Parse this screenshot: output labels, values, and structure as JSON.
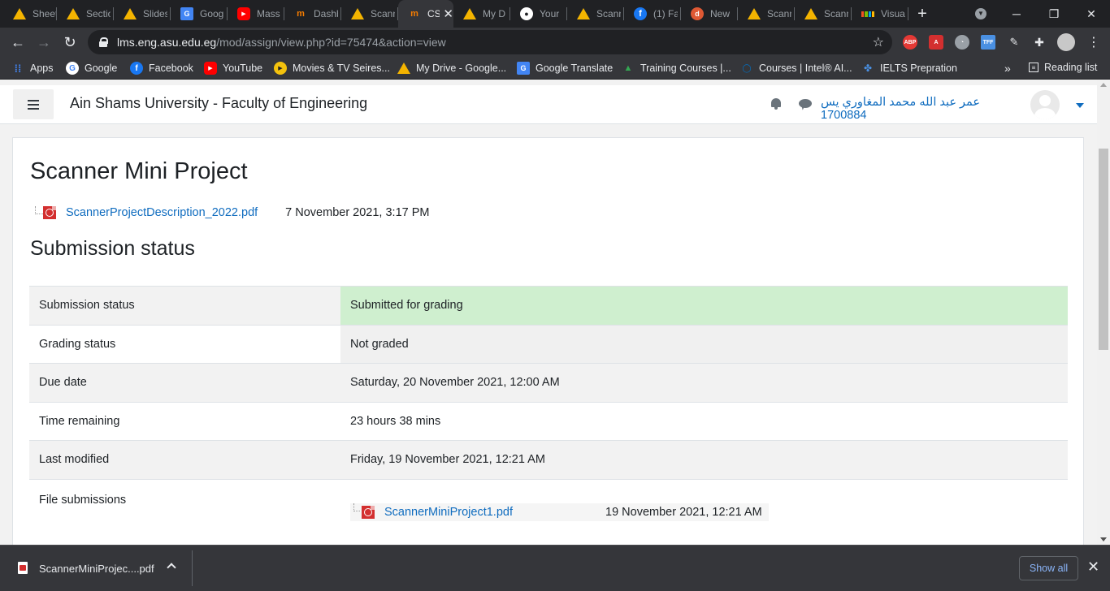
{
  "browser": {
    "tabs": [
      {
        "title": "Sheet",
        "icon": "google-drive-icon"
      },
      {
        "title": "Sectio",
        "icon": "google-drive-icon"
      },
      {
        "title": "Slides",
        "icon": "google-drive-icon"
      },
      {
        "title": "Goog",
        "icon": "google-translate-icon"
      },
      {
        "title": "Mass",
        "icon": "youtube-icon"
      },
      {
        "title": "Dashb",
        "icon": "moodle-icon"
      },
      {
        "title": "Scann",
        "icon": "google-drive-icon"
      },
      {
        "title": "CS",
        "icon": "moodle-icon",
        "active": true
      },
      {
        "title": "My D",
        "icon": "google-drive-icon"
      },
      {
        "title": "Your",
        "icon": "github-icon"
      },
      {
        "title": "Scann",
        "icon": "google-drive-icon"
      },
      {
        "title": "(1) Fa",
        "icon": "facebook-icon"
      },
      {
        "title": "New",
        "icon": "duckduckgo-icon"
      },
      {
        "title": "Scann",
        "icon": "google-drive-icon"
      },
      {
        "title": "Scann",
        "icon": "google-drive-icon"
      },
      {
        "title": "Visua",
        "icon": "microsoft-icon"
      }
    ],
    "url_host": "lms.eng.asu.edu.eg",
    "url_path": "/mod/assign/view.php?id=75474&action=view",
    "extensions": [
      "ABP",
      "TFF"
    ],
    "bookmarks": [
      {
        "label": "Apps",
        "icon": "apps-grid-icon"
      },
      {
        "label": "Google",
        "icon": "google-icon"
      },
      {
        "label": "Facebook",
        "icon": "facebook-icon"
      },
      {
        "label": "YouTube",
        "icon": "youtube-icon"
      },
      {
        "label": "Movies & TV Seires...",
        "icon": "movies-icon"
      },
      {
        "label": "My Drive - Google...",
        "icon": "google-drive-icon"
      },
      {
        "label": "Google Translate",
        "icon": "google-translate-icon"
      },
      {
        "label": "Training Courses  |...",
        "icon": "training-icon"
      },
      {
        "label": "Courses | Intel® AI...",
        "icon": "intel-icon"
      },
      {
        "label": "IELTS Prepration",
        "icon": "ielts-icon"
      }
    ],
    "overflow_label": "»",
    "reading_list_label": "Reading list"
  },
  "site": {
    "name": "Ain Shams University - Faculty of Engineering",
    "user_name": "عمر عبد الله محمد المغاوري يس 1700884"
  },
  "assignment": {
    "title": "Scanner Mini Project",
    "attachment": {
      "name": "ScannerProjectDescription_2022.pdf",
      "date": "7 November 2021, 3:17 PM"
    },
    "section_title": "Submission status",
    "rows": [
      {
        "key": "Submission status",
        "value": "Submitted for grading"
      },
      {
        "key": "Grading status",
        "value": "Not graded"
      },
      {
        "key": "Due date",
        "value": "Saturday, 20 November 2021, 12:00 AM"
      },
      {
        "key": "Time remaining",
        "value": "23 hours 38 mins"
      },
      {
        "key": "Last modified",
        "value": "Friday, 19 November 2021, 12:21 AM"
      },
      {
        "key": "File submissions"
      }
    ],
    "submitted_file": {
      "name": "ScannerMiniProject1.pdf",
      "date": "19 November 2021, 12:21 AM"
    }
  },
  "download_shelf": {
    "file_name": "ScannerMiniProjec....pdf",
    "show_all_label": "Show all"
  },
  "colors": {
    "link": "#0f6cbf",
    "submitted_bg": "#cfefcf",
    "chrome_dark": "#202124",
    "chrome_toolbar": "#35363a"
  }
}
